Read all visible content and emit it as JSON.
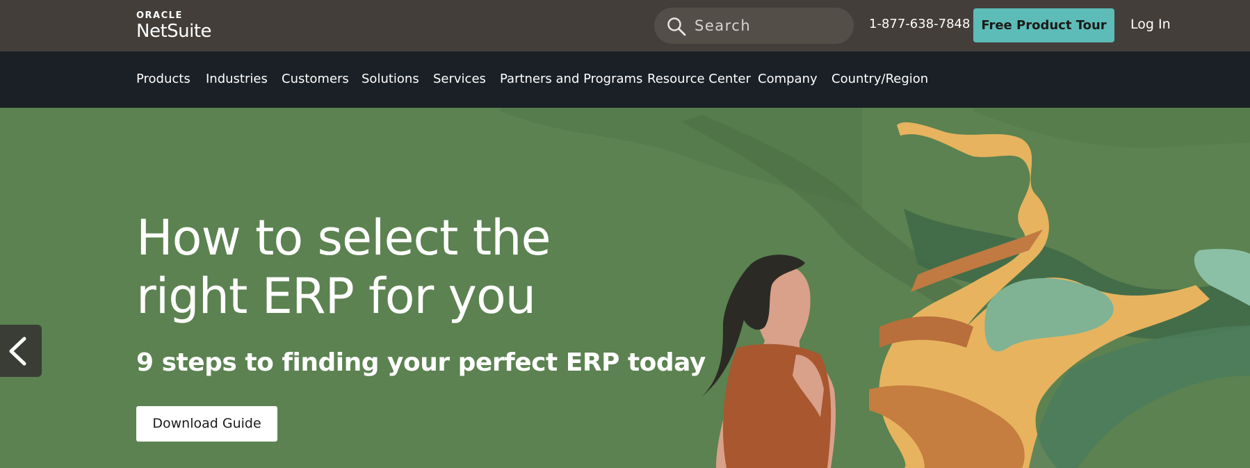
{
  "header": {
    "logo_top": "ORACLE",
    "logo_bottom": "NetSuite",
    "search_placeholder": "Search",
    "phone": "1-877-638-7848",
    "tour_button": "Free Product Tour",
    "login": "Log In"
  },
  "nav": {
    "items": [
      "Products",
      "Industries",
      "Customers",
      "Solutions",
      "Services",
      "Partners and Programs",
      "Resource Center",
      "Company",
      "Country/Region"
    ]
  },
  "hero": {
    "headline_line1": "How to select the",
    "headline_line2": "right ERP for you",
    "subheadline": "9 steps to finding your perfect ERP today",
    "cta": "Download Guide"
  },
  "colors": {
    "topbar": "#433e3a",
    "nav": "#1b2026",
    "hero_bg": "#5b8250",
    "accent": "#5dbcb7"
  },
  "icons": {
    "search": "search-icon",
    "prev": "chevron-left-icon"
  }
}
